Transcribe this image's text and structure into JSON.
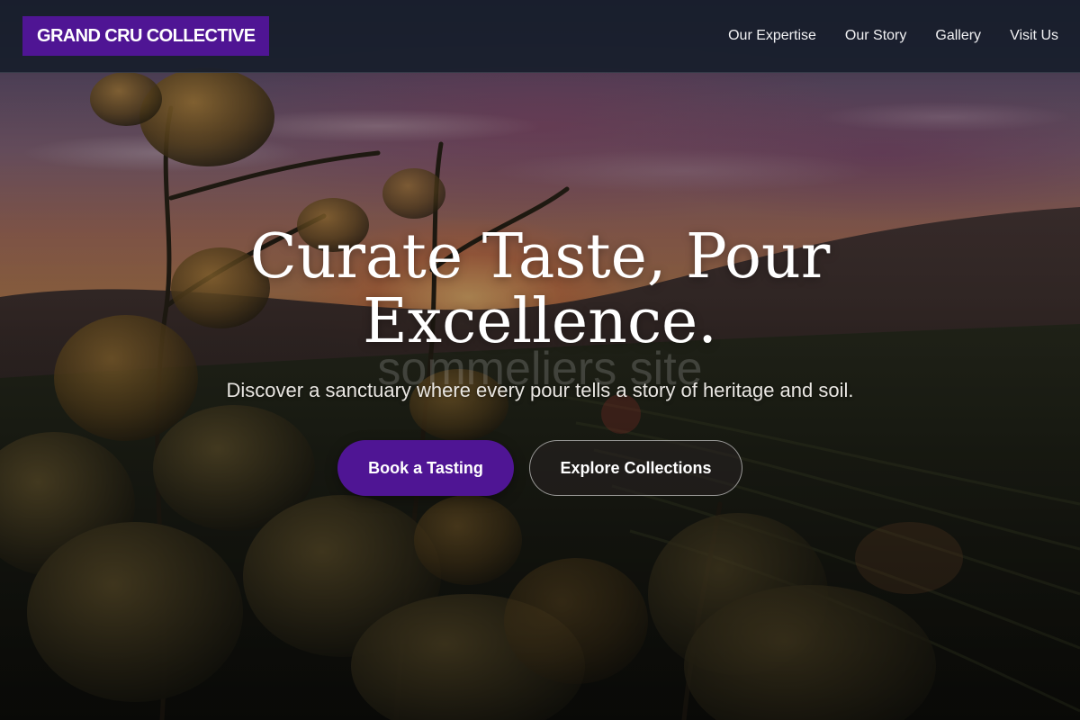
{
  "brand": {
    "name": "GRAND CRU COLLECTIVE"
  },
  "nav": {
    "links": [
      {
        "label": "Our Expertise"
      },
      {
        "label": "Our Story"
      },
      {
        "label": "Gallery"
      },
      {
        "label": "Visit Us"
      }
    ]
  },
  "hero": {
    "headline": "Curate Taste, Pour Excellence.",
    "watermark": "sommeliers site",
    "subtitle": "Discover a sanctuary where every pour tells a story of heritage and soil.",
    "primary_button": "Book a Tasting",
    "secondary_button": "Explore Collections"
  },
  "colors": {
    "brand_purple": "#4f1594",
    "navbar_bg": "#181e2c",
    "text_white": "#ffffff"
  }
}
